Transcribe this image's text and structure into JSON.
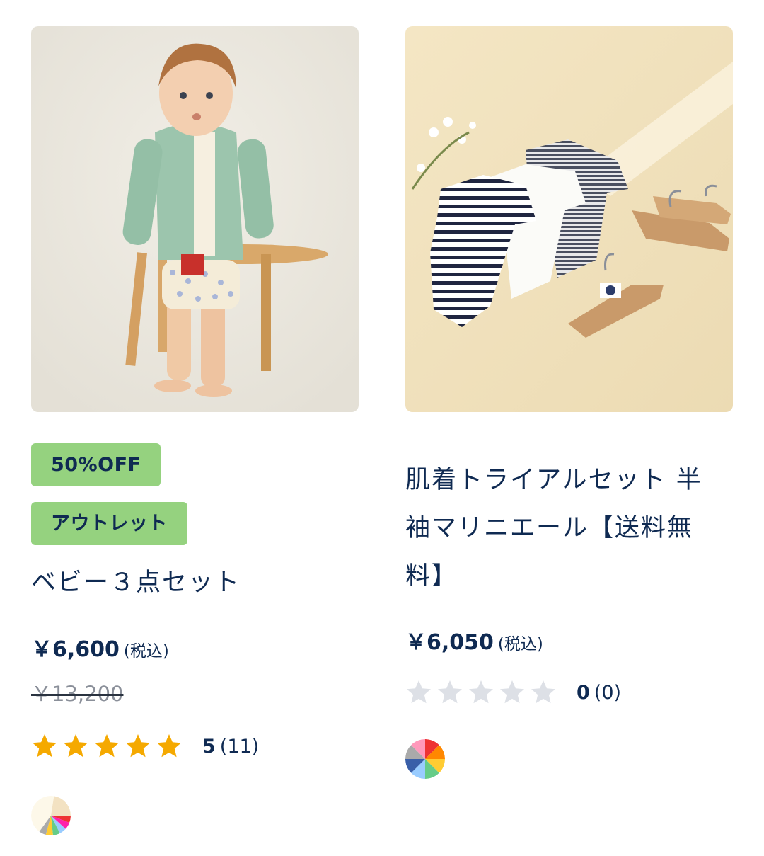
{
  "products": [
    {
      "image_alt": "baby-cardigan-photo",
      "badges": [
        "50%OFF",
        "アウトレット"
      ],
      "title": "ベビー３点セット",
      "price": "￥6,600",
      "tax_label": "(税込)",
      "original_price": "￥13,200",
      "rating_value": 5,
      "rating_label": "5",
      "review_count": "(11)",
      "swatch_colors": [
        "#fdf8e9",
        "#f3e2c2",
        "#e33",
        "#f2a",
        "#9cf",
        "#6c8",
        "#fc3",
        "#aaa"
      ]
    },
    {
      "image_alt": "baby-bodysuits-photo",
      "badges": [],
      "title": "肌着トライアルセット 半袖マリニエール【送料無料】",
      "price": "￥6,050",
      "tax_label": "(税込)",
      "original_price": "",
      "rating_value": 0,
      "rating_label": "0",
      "review_count": "(0)",
      "swatch_colors": [
        "#e33",
        "#f80",
        "#fc3",
        "#6c8",
        "#9cf",
        "#3a5fa8",
        "#aaa",
        "#f9b"
      ]
    }
  ],
  "colors": {
    "text": "#0f2a52",
    "badge_bg": "#95d27f",
    "star_filled": "#f5a900",
    "star_empty": "#dde0e6"
  }
}
